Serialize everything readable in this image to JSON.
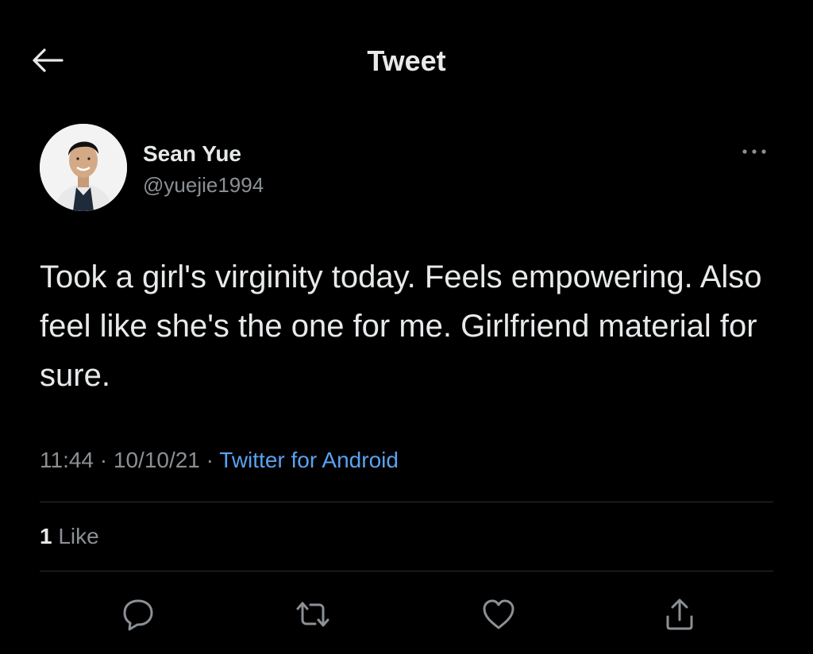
{
  "header": {
    "title": "Tweet",
    "back_icon": "arrow-left-icon"
  },
  "author": {
    "name": "Sean Yue",
    "handle": "@yuejie1994",
    "avatar_icon": "avatar-photo",
    "more_icon": "more-horizontal-icon"
  },
  "tweet": {
    "text": "Took a girl's virginity today. Feels empowering. Also feel like she's the one for me. Girlfriend material for sure.",
    "time": "11:44",
    "date": "10/10/21",
    "separator": "·",
    "source": "Twitter for Android"
  },
  "stats": {
    "likes_count": "1",
    "likes_label": "Like"
  },
  "actions": [
    {
      "name": "reply",
      "icon": "reply-icon"
    },
    {
      "name": "retweet",
      "icon": "retweet-icon"
    },
    {
      "name": "like",
      "icon": "heart-icon"
    },
    {
      "name": "share",
      "icon": "share-icon"
    }
  ],
  "colors": {
    "background": "#000000",
    "text": "#e7e9ea",
    "secondary_text": "#8b9095",
    "link": "#5aa2f0",
    "divider": "#2a2e32"
  }
}
